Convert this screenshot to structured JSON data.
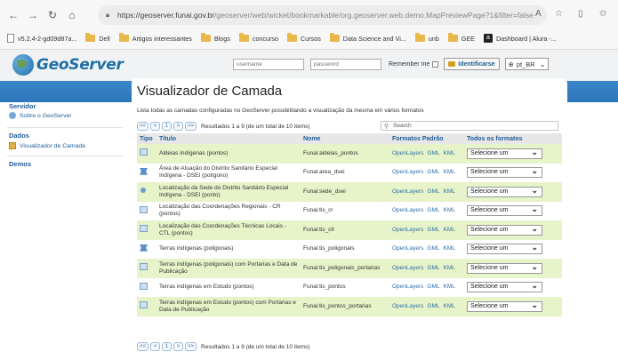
{
  "browser": {
    "url_host": "https://geoserver.funai.gov.br",
    "url_path": "/geoserver/web/wicket/bookmarkable/org.geoserver.web.demo.MapPreviewPage?1&filter=false",
    "bookmarks": [
      {
        "label": "v5.2.4-2-gd09d87a...",
        "icon": "page-icon"
      },
      {
        "label": "Dell",
        "icon": "folder-icon"
      },
      {
        "label": "Artigos interessantes",
        "icon": "folder-icon"
      },
      {
        "label": "Blogs",
        "icon": "folder-icon"
      },
      {
        "label": "concurso",
        "icon": "folder-icon"
      },
      {
        "label": "Cursos",
        "icon": "folder-icon"
      },
      {
        "label": "Data Science and Vi...",
        "icon": "folder-icon"
      },
      {
        "label": "unb",
        "icon": "folder-icon"
      },
      {
        "label": "GEE",
        "icon": "folder-icon"
      },
      {
        "label": "Dashboard | Alura -...",
        "icon": "alura-icon"
      }
    ]
  },
  "header": {
    "logo_text": "GeoServer",
    "username_placeholder": "username",
    "password_placeholder": "password",
    "remember_label": "Remember me",
    "login_button": "Identificarse",
    "language": "pt_BR"
  },
  "sidebar": {
    "server_heading": "Servidor",
    "about_label": "Sobre o GeoServer",
    "data_heading": "Dados",
    "preview_label": "Visualizador de Camada",
    "demos_heading": "Demos"
  },
  "main": {
    "title": "Visualizador de Camada",
    "description": "Lista todas as camadas configuradas no GeoServer possibilitando a visualização da mesma em vários formatos",
    "pager": {
      "first": "<<",
      "prev": "<",
      "page": "1",
      "next": ">",
      "last": ">>",
      "results": "Resultados 1 a 9 (de um total de 10 items)"
    },
    "search_placeholder": "Search",
    "columns": {
      "type": "Tipo",
      "title": "Título",
      "name": "Nome",
      "formats": "Formatos Padrão",
      "all_formats": "Todos os formatos"
    },
    "format_links": [
      "OpenLayers",
      "GML",
      "KML"
    ],
    "select_default": "Selecione um",
    "rows": [
      {
        "type": "raster",
        "title": "Aldeias Indígenas (pontos)",
        "name": "Funai:aldeias_pontos"
      },
      {
        "type": "polygon",
        "title": "Área de Atuação do Distrito Sanitário Especial Indígena - DSEI (polígono)",
        "name": "Funai:area_dsei"
      },
      {
        "type": "point",
        "title": "Localização da Sede do Distrito Sanitário Especial Indígena - DSEI (ponto)",
        "name": "Funai:sede_dsei"
      },
      {
        "type": "raster",
        "title": "Localização das Coordenações Regionais - CR (pontos)",
        "name": "Funai:tis_cr"
      },
      {
        "type": "raster",
        "title": "Localização das Coordenações Técnicas Locais - CTL (pontos)",
        "name": "Funai:tis_ctl"
      },
      {
        "type": "polygon",
        "title": "Terras indígenas (poligonais)",
        "name": "Funai:tis_poligonais"
      },
      {
        "type": "raster",
        "title": "Terras indígenas (poligonais) com Portarias e Data de Publicação",
        "name": "Funai:tis_poligonais_portarias"
      },
      {
        "type": "raster",
        "title": "Terras indígenas em Estudo (pontos)",
        "name": "Funai:tis_pontos"
      },
      {
        "type": "raster",
        "title": "Terras indígenas em Estudo (pontos) com Portarias e Data de Publicação",
        "name": "Funai:tis_pontos_portarias"
      }
    ]
  },
  "colors": {
    "accent_blue": "#2d76b9",
    "row_alt": "#e7f3c9",
    "link": "#2f6fa8"
  }
}
